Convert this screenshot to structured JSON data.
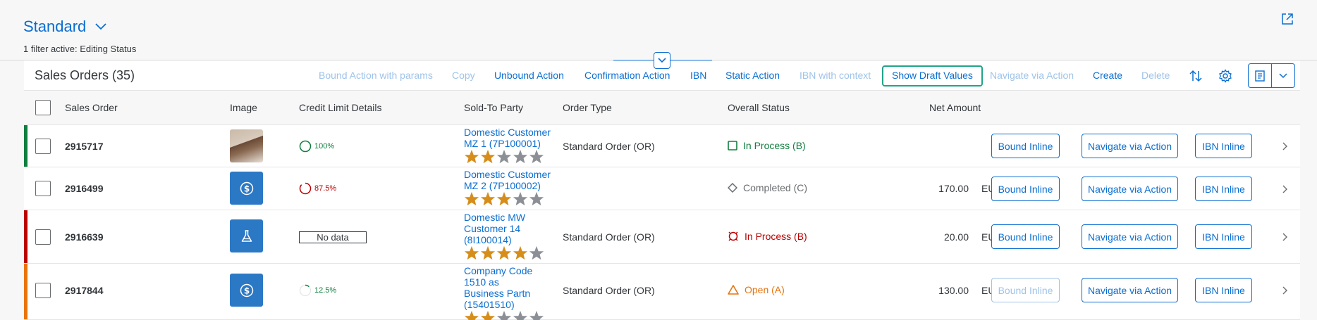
{
  "header": {
    "variant_title": "Standard",
    "filter_info": "1 filter active: Editing Status"
  },
  "toolbar": {
    "title": "Sales Orders (35)",
    "buttons": [
      {
        "label": "Bound Action with params",
        "enabled": false
      },
      {
        "label": "Copy",
        "enabled": false
      },
      {
        "label": "Unbound Action",
        "enabled": true
      },
      {
        "label": "Confirmation Action",
        "enabled": true
      },
      {
        "label": "IBN",
        "enabled": true
      },
      {
        "label": "Static Action",
        "enabled": true
      },
      {
        "label": "IBN with context",
        "enabled": false
      },
      {
        "label": "Show Draft Values",
        "enabled": true
      },
      {
        "label": "Navigate via Action",
        "enabled": false
      },
      {
        "label": "Create",
        "enabled": true
      },
      {
        "label": "Delete",
        "enabled": false
      }
    ]
  },
  "columns": [
    "Sales Order",
    "Image",
    "Credit Limit Details",
    "Sold-To Party",
    "Order Type",
    "Overall Status",
    "Net Amount"
  ],
  "rows": [
    {
      "sales_order": "2915717",
      "image": "photo",
      "credit_pct": "100%",
      "credit_fraction": 1.0,
      "credit_color": "#107e3e",
      "party": "Domestic Customer MZ 1 (7P100001)",
      "rating": 2,
      "order_type": "Standard Order (OR)",
      "status": "In Process (B)",
      "status_color": "#107e3e",
      "status_icon": "square-icon",
      "amount": "",
      "currency": "",
      "highlight": "#107e3e",
      "bound_enabled": true
    },
    {
      "sales_order": "2916499",
      "image": "dollar-icon",
      "credit_pct": "87.5%",
      "credit_fraction": 0.875,
      "credit_color": "#bb0000",
      "party": "Domestic Customer MZ 2 (7P100002)",
      "rating": 3,
      "order_type": "",
      "status": "Completed (C)",
      "status_color": "#6a6d70",
      "status_icon": "diamond-icon",
      "amount": "170.00",
      "currency": "EUR",
      "highlight": "",
      "bound_enabled": true
    },
    {
      "sales_order": "2916639",
      "image": "flask-icon",
      "credit_text": "No data",
      "party": "Domestic MW Customer 14 (8I100014)",
      "rating": 4,
      "order_type": "Standard Order (OR)",
      "status": "In Process (B)",
      "status_color": "#bb0000",
      "status_icon": "alert-circle-icon",
      "amount": "20.00",
      "currency": "EUR",
      "highlight": "#bb0000",
      "bound_enabled": true
    },
    {
      "sales_order": "2917844",
      "image": "dollar-icon",
      "credit_pct": "12.5%",
      "credit_fraction": 0.125,
      "credit_color": "#107e3e",
      "party": "Company Code 1510 as Business Partn (15401510)",
      "rating": 2,
      "order_type": "Standard Order (OR)",
      "status": "Open (A)",
      "status_color": "#e9730c",
      "status_icon": "triangle-icon",
      "amount": "130.00",
      "currency": "EUR",
      "highlight": "#e9730c",
      "bound_enabled": false
    }
  ],
  "row_actions": {
    "bound_inline": "Bound Inline",
    "navigate_via_action": "Navigate via Action",
    "ibn_inline": "IBN Inline"
  },
  "colors": {
    "accent": "#0a6ed1",
    "disabled": "#9fc3e8",
    "focus": "#1fa48a",
    "star_on": "#d68d1a",
    "star_off": "#8c9096"
  }
}
